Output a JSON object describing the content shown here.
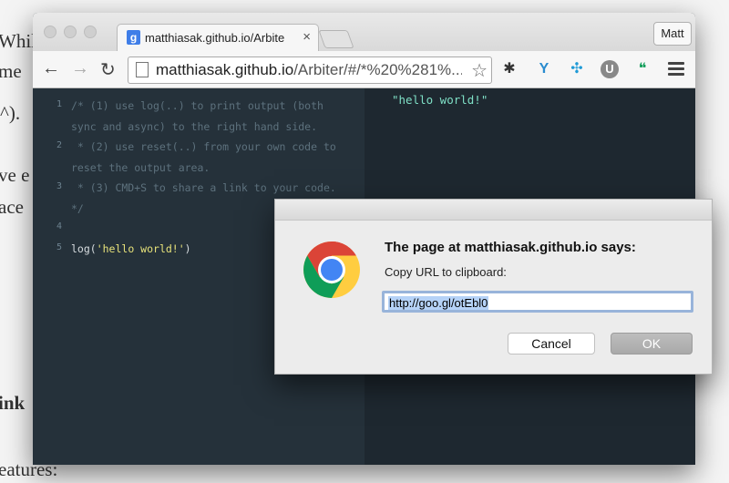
{
  "background_page": {
    "fragments": [
      "Whil",
      "me",
      "^).",
      "ve e",
      "ace",
      "ink",
      "eatures:"
    ]
  },
  "window": {
    "tab_title": "matthiasak.github.io/Arbite",
    "favicon_letter": "g",
    "tab_close": "×",
    "profile_name": "Matt",
    "url_host": "matthiasak.github.io",
    "url_rest": "/Arbiter/#/*%20%281%...",
    "nav": {
      "back": "←",
      "forward": "→",
      "reload": "↻",
      "star": "☆"
    },
    "extensions": [
      {
        "name": "asterisk-extension-icon",
        "glyph": "✱",
        "color": "#333333"
      },
      {
        "name": "y-extension-icon",
        "glyph": "Y",
        "color": "#2a8ccf"
      },
      {
        "name": "network-extension-icon",
        "glyph": "✣",
        "color": "#1e9ad6"
      },
      {
        "name": "u-extension-icon",
        "glyph": "U",
        "color": "#888888"
      },
      {
        "name": "hangouts-extension-icon",
        "glyph": "❝",
        "color": "#0f9d58"
      }
    ]
  },
  "editor": {
    "lines": [
      {
        "num": "1",
        "text": "/* (1) use log(..) to print output (both"
      },
      {
        "num": "",
        "text": "sync and async) to the right hand side."
      },
      {
        "num": "2",
        "text": " * (2) use reset(..) from your own code to"
      },
      {
        "num": "",
        "text": "reset the output area."
      },
      {
        "num": "3",
        "text": " * (3) CMD+S to share a link to your code."
      },
      {
        "num": "",
        "text": "*/"
      },
      {
        "num": "4",
        "text": ""
      },
      {
        "num": "5",
        "fn": "log(",
        "str": "'hello world!'",
        "close": ")"
      }
    ]
  },
  "output": {
    "text": "\"hello world!\""
  },
  "dialog": {
    "title": "The page at matthiasak.github.io says:",
    "message": "Copy URL to clipboard:",
    "input_value": "http://goo.gl/otEbl0",
    "cancel_label": "Cancel",
    "ok_label": "OK"
  }
}
